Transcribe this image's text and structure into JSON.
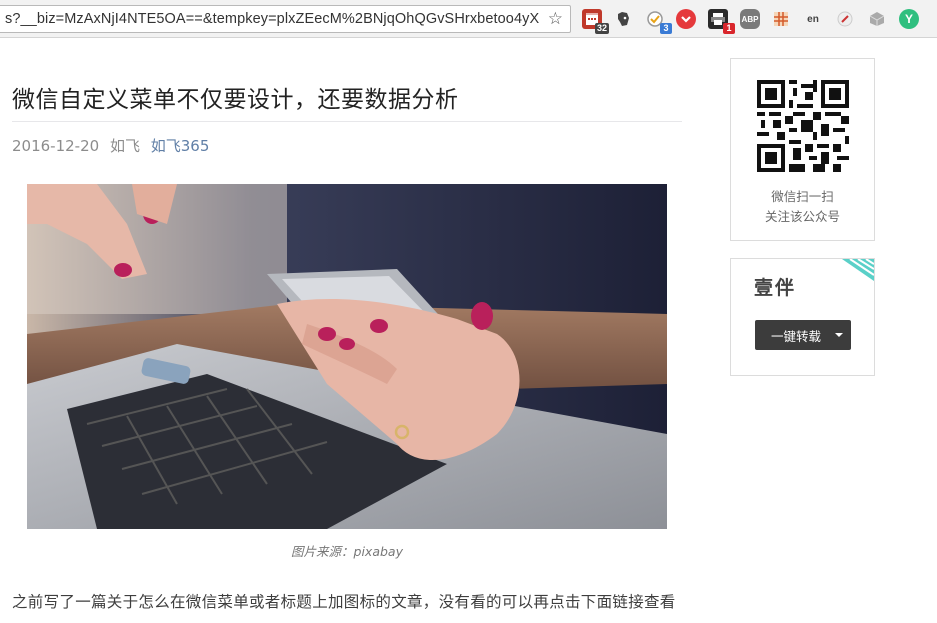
{
  "browser": {
    "url": "s?__biz=MzAxNjI4NTE5OA==&tempkey=plxZEecM%2BNjqOhQGvSHrxbetoo4yX",
    "star_icon": "bookmark-star-icon",
    "extensions": [
      {
        "name": "calendar-extension-icon",
        "badge": "32",
        "color": "#c0392b"
      },
      {
        "name": "evernote-extension-icon",
        "badge": "",
        "color": "#444444"
      },
      {
        "name": "tasks-extension-icon",
        "badge": "3",
        "color": "#3a7bd5"
      },
      {
        "name": "pocket-extension-icon",
        "badge": "",
        "color": "#e5393c"
      },
      {
        "name": "printer-extension-icon",
        "badge": "1",
        "color": "#2b2b2b"
      },
      {
        "name": "adblock-plus-extension-icon",
        "label": "ABP",
        "badge": "",
        "color": "#7a7a7a"
      },
      {
        "name": "grid-extension-icon",
        "badge": "",
        "color": "#d45a2a"
      },
      {
        "name": "translate-extension-icon",
        "label": "en",
        "badge": "",
        "color": "#555555"
      },
      {
        "name": "pen-extension-icon",
        "badge": "",
        "color": "#cc3333"
      },
      {
        "name": "cube-extension-icon",
        "badge": "",
        "color": "#999999"
      },
      {
        "name": "vue-extension-icon",
        "label": "Y",
        "badge": "",
        "color": "#2fbf7f"
      }
    ]
  },
  "article": {
    "title": "微信自定义菜单不仅要设计，还要数据分析",
    "date": "2016-12-20",
    "author": "如飞",
    "account": "如飞365",
    "photo_caption": "图片来源：pixabay",
    "paragraph": "之前写了一篇关于怎么在微信菜单或者标题上加图标的文章，没有看的可以再点击下面链接查看"
  },
  "sidebar": {
    "qr_line1": "微信扫一扫",
    "qr_line2": "关注该公众号",
    "share_logo": "壹伴",
    "share_button": "一键转载",
    "corner_color": "#5ad0c8"
  }
}
